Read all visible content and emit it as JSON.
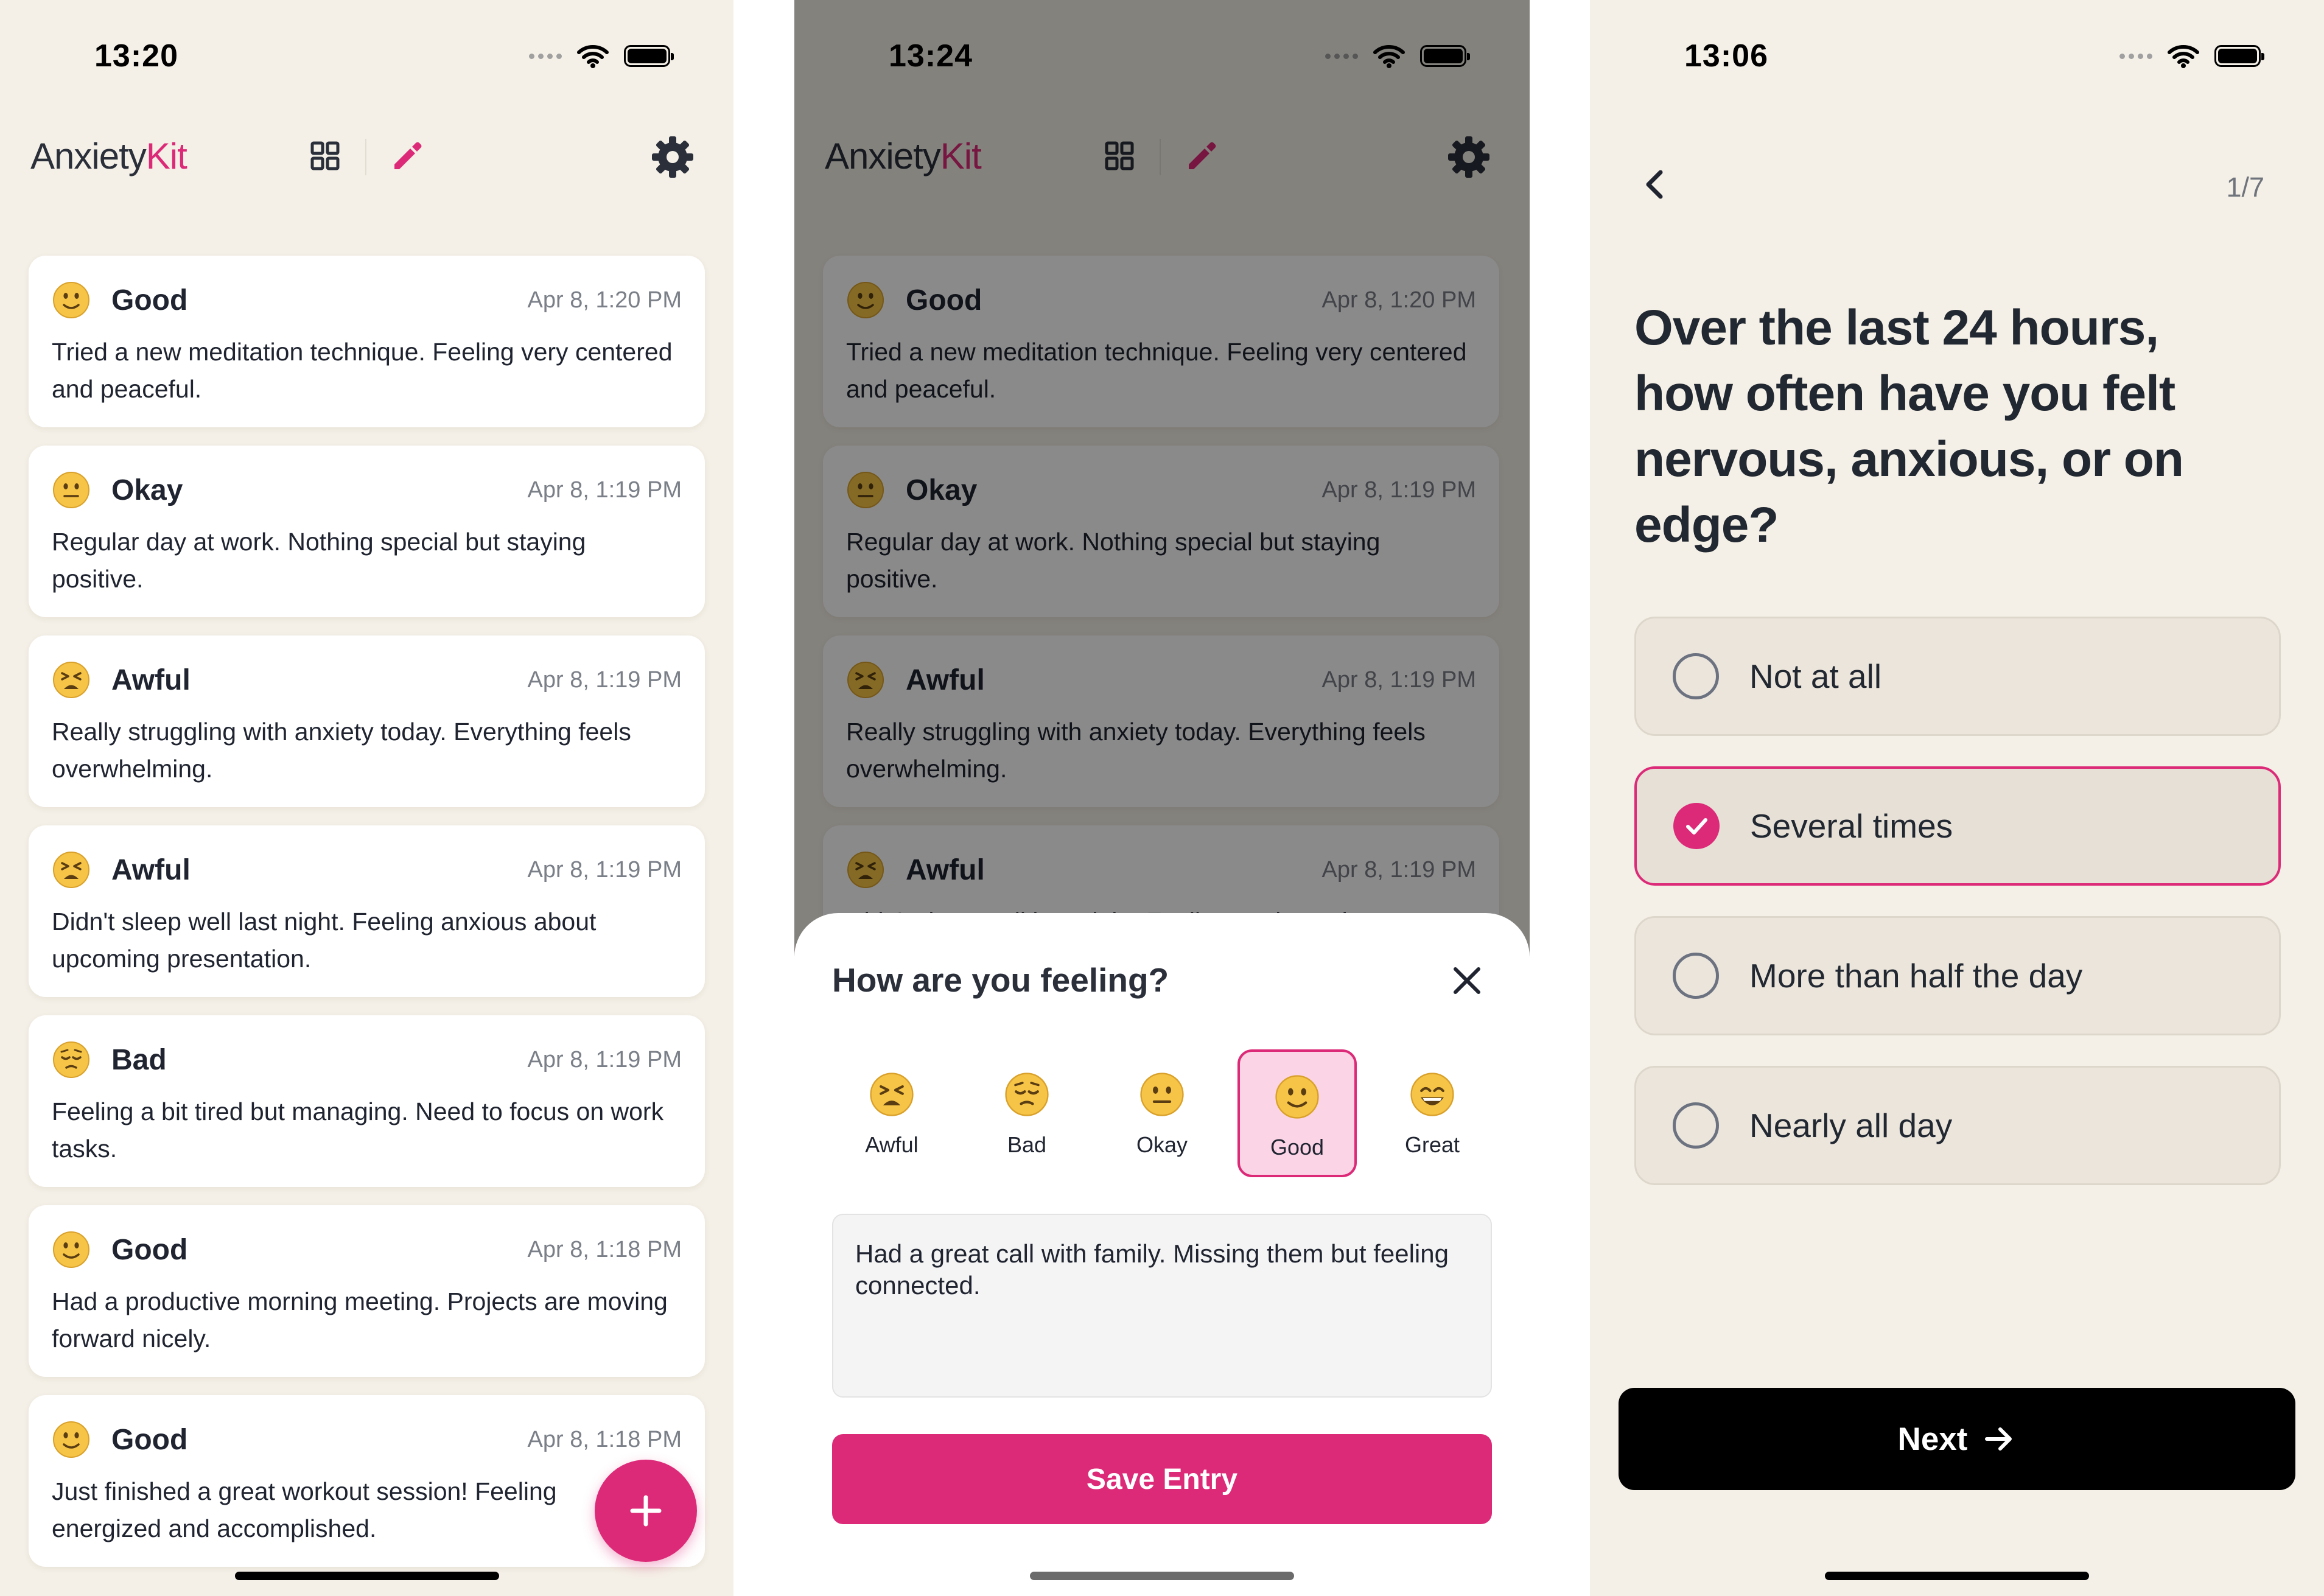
{
  "colors": {
    "accent": "#dc2a78",
    "background": "#f4f0e7",
    "card": "#ffffff",
    "text": "#1f2430",
    "muted": "#7a7f88"
  },
  "journal": {
    "status_time": "13:20",
    "brand_prefix": "Anxiety",
    "brand_accent": "Kit",
    "header_icons": [
      "grid-icon",
      "pencil-icon",
      "gear-icon"
    ],
    "entries": [
      {
        "emoji": "slightly-smiling-face",
        "mood": "Good",
        "date": "Apr 8, 1:20 PM",
        "note": "Tried a new meditation technique. Feeling very centered and peaceful."
      },
      {
        "emoji": "neutral-face",
        "mood": "Okay",
        "date": "Apr 8, 1:19 PM",
        "note": "Regular day at work. Nothing special but staying positive."
      },
      {
        "emoji": "tired-face",
        "mood": "Awful",
        "date": "Apr 8, 1:19 PM",
        "note": "Really struggling with anxiety today. Everything feels overwhelming."
      },
      {
        "emoji": "tired-face",
        "mood": "Awful",
        "date": "Apr 8, 1:19 PM",
        "note": "Didn't sleep well last night. Feeling anxious about upcoming presentation."
      },
      {
        "emoji": "pensive-face",
        "mood": "Bad",
        "date": "Apr 8, 1:19 PM",
        "note": "Feeling a bit tired but managing. Need to focus on work tasks."
      },
      {
        "emoji": "slightly-smiling-face",
        "mood": "Good",
        "date": "Apr 8, 1:18 PM",
        "note": "Had a productive morning meeting. Projects are moving forward nicely."
      },
      {
        "emoji": "slightly-smiling-face",
        "mood": "Good",
        "date": "Apr 8, 1:18 PM",
        "note": "Just finished a great workout session! Feeling energized and accomplished."
      }
    ],
    "fab_icon": "plus-icon"
  },
  "entry_sheet": {
    "status_time": "13:24",
    "title": "How are you feeling?",
    "moods": [
      {
        "label": "Awful",
        "emoji": "tired-face"
      },
      {
        "label": "Bad",
        "emoji": "pensive-face"
      },
      {
        "label": "Okay",
        "emoji": "neutral-face"
      },
      {
        "label": "Good",
        "emoji": "slightly-smiling-face"
      },
      {
        "label": "Great",
        "emoji": "grinning-face"
      }
    ],
    "selected_mood": "Good",
    "note_value": "Had a great call with family. Missing them but feeling connected.",
    "save_label": "Save Entry"
  },
  "assessment": {
    "status_time": "13:06",
    "progress": "1/7",
    "question": "Over the last 24 hours, how often have you felt nervous, anxious, or on edge?",
    "options": [
      "Not at all",
      "Several times",
      "More than half the day",
      "Nearly all day"
    ],
    "selected_option": "Several times",
    "next_label": "Next"
  }
}
